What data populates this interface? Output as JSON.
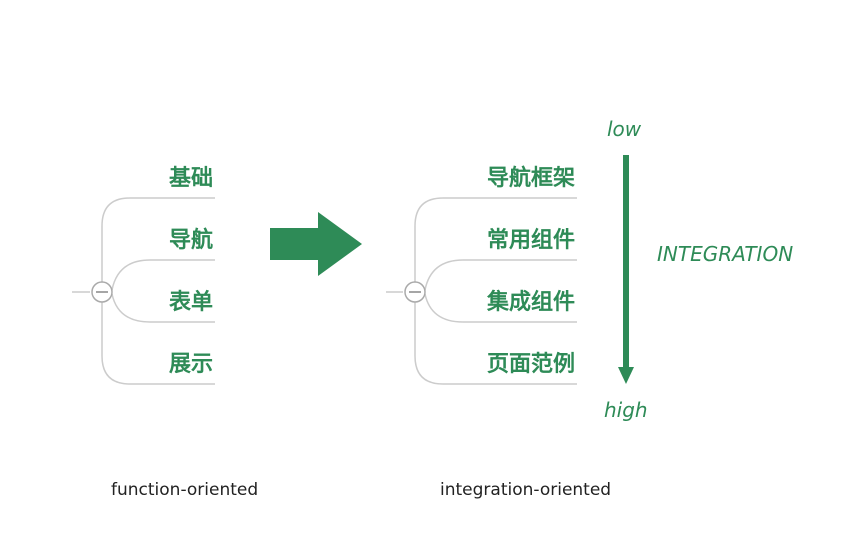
{
  "colors": {
    "accent": "#2e8b57",
    "branch_line": "#cccccc",
    "caption_text": "#222222"
  },
  "left_tree": {
    "collapse_icon": "minus-circle-icon",
    "items": [
      "基础",
      "导航",
      "表单",
      "展示"
    ],
    "caption": "function-oriented"
  },
  "transition_icon": "right-arrow-icon",
  "right_tree": {
    "collapse_icon": "minus-circle-icon",
    "items": [
      "导航框架",
      "常用组件",
      "集成组件",
      "页面范例"
    ],
    "caption": "integration-oriented"
  },
  "axis": {
    "top_label": "low",
    "bottom_label": "high",
    "name": "INTEGRATION",
    "direction_icon": "down-arrow-icon"
  }
}
